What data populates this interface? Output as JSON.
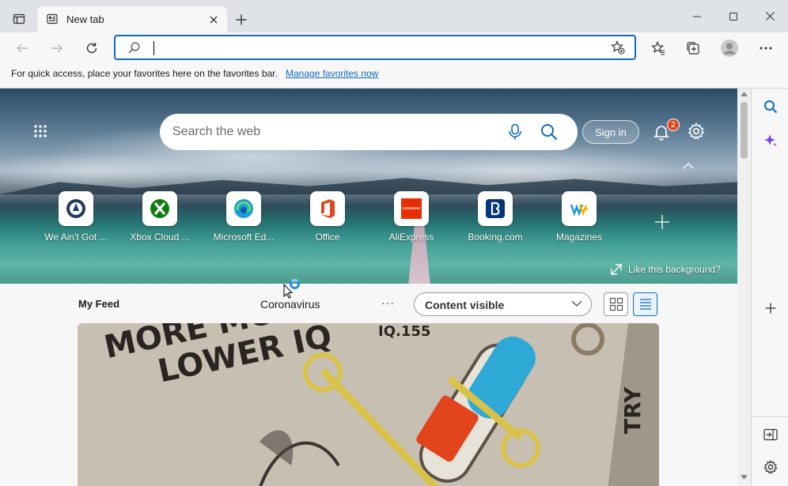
{
  "tab": {
    "title": "New tab"
  },
  "address": {
    "value": "",
    "placeholder": ""
  },
  "favbar": {
    "hint": "For quick access, place your favorites here on the favorites bar.",
    "link": "Manage favorites now"
  },
  "hero": {
    "search_placeholder": "Search the web",
    "signin": "Sign in",
    "notification_count": "2",
    "like_bg": "Like this background?"
  },
  "quicklinks": [
    {
      "label": "We Ain't Got ...",
      "icon": "wagt-logo-icon"
    },
    {
      "label": "Xbox Cloud ...",
      "icon": "xbox-icon"
    },
    {
      "label": "Microsoft Ed...",
      "icon": "edge-icon"
    },
    {
      "label": "Office",
      "icon": "office-icon"
    },
    {
      "label": "AliExpress",
      "icon": "aliexpress-icon"
    },
    {
      "label": "Booking.com",
      "icon": "booking-icon"
    },
    {
      "label": "Magazines",
      "icon": "magazines-icon"
    }
  ],
  "feed": {
    "my_feed": "My Feed",
    "topic": "Coronavirus",
    "more": "···",
    "content_select": "Content visible",
    "card": {
      "headline1": "MORE MOVES",
      "headline2": "LOWER IQ",
      "tag": "IQ.155",
      "try": "TRY"
    }
  },
  "colors": {
    "accent": "#0f6cbd",
    "badge": "#e0471c",
    "titlebar": "#dfe3e8"
  }
}
